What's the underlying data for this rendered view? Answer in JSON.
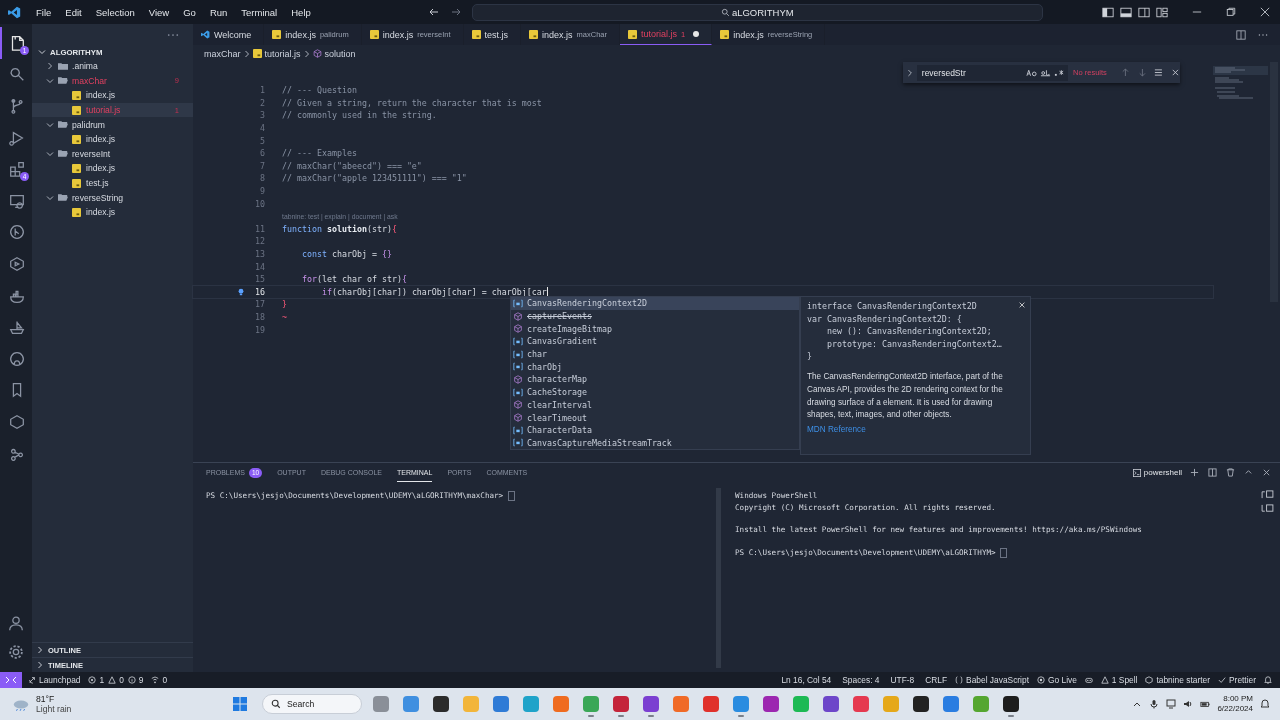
{
  "menu": [
    "File",
    "Edit",
    "Selection",
    "View",
    "Go",
    "Run",
    "Terminal",
    "Help"
  ],
  "command_center": "aLGORITHYM",
  "activity": [
    {
      "kind": "files",
      "badge": "1",
      "selected": true
    },
    {
      "kind": "search",
      "selected": false
    },
    {
      "kind": "scm",
      "selected": false
    },
    {
      "kind": "debug",
      "selected": false
    },
    {
      "kind": "extensions",
      "badge": "4",
      "selected": false
    },
    {
      "kind": "remote",
      "selected": false
    },
    {
      "kind": "graph",
      "selected": false
    },
    {
      "kind": "test",
      "selected": false
    },
    {
      "kind": "docker",
      "selected": false
    },
    {
      "kind": "ship",
      "selected": false
    },
    {
      "kind": "github",
      "selected": false
    },
    {
      "kind": "bookmark",
      "selected": false
    },
    {
      "kind": "tabnine",
      "selected": false
    },
    {
      "kind": "share",
      "selected": false
    }
  ],
  "explorer": {
    "title": "ALGORITHYM",
    "tree": [
      {
        "name": ".anima",
        "kind": "folder",
        "expanded": false,
        "error": false,
        "selected": false
      },
      {
        "name": "maxChar",
        "kind": "folder",
        "expanded": true,
        "error": true,
        "badge": "9",
        "selected": false,
        "children": [
          {
            "name": "index.js",
            "kind": "file",
            "error": false,
            "selected": false
          },
          {
            "name": "tutorial.js",
            "kind": "file",
            "error": true,
            "badge": "1",
            "selected": true
          }
        ]
      },
      {
        "name": "palidrum",
        "kind": "folder",
        "expanded": true,
        "error": false,
        "selected": false,
        "children": [
          {
            "name": "index.js",
            "kind": "file",
            "error": false,
            "selected": false
          }
        ]
      },
      {
        "name": "reverseInt",
        "kind": "folder",
        "expanded": true,
        "error": false,
        "selected": false,
        "children": [
          {
            "name": "index.js",
            "kind": "file",
            "error": false,
            "selected": false
          },
          {
            "name": "test.js",
            "kind": "file",
            "error": false,
            "selected": false
          }
        ]
      },
      {
        "name": "reverseString",
        "kind": "folder",
        "expanded": true,
        "error": false,
        "selected": false,
        "children": [
          {
            "name": "index.js",
            "kind": "file",
            "error": false,
            "selected": false
          }
        ]
      }
    ],
    "sections": [
      {
        "label": "OUTLINE",
        "expanded": false
      },
      {
        "label": "TIMELINE",
        "expanded": false
      }
    ]
  },
  "tabs": [
    {
      "label": "Welcome",
      "kind": "welcome",
      "selected": false,
      "error": false,
      "modified": false
    },
    {
      "label": "index.js",
      "description": "palidrum",
      "kind": "js",
      "selected": false,
      "error": false,
      "modified": false
    },
    {
      "label": "index.js",
      "description": "reverseInt",
      "kind": "js",
      "selected": false,
      "error": false,
      "modified": false
    },
    {
      "label": "test.js",
      "kind": "js",
      "selected": false,
      "error": false,
      "modified": false
    },
    {
      "label": "index.js",
      "description": "maxChar",
      "kind": "js",
      "selected": false,
      "error": false,
      "modified": false
    },
    {
      "label": "tutorial.js",
      "badge": "1",
      "kind": "js",
      "selected": true,
      "error": true,
      "modified": true
    },
    {
      "label": "index.js",
      "description": "reverseString",
      "kind": "js",
      "selected": false,
      "error": false,
      "modified": false
    }
  ],
  "breadcrumbs": [
    {
      "label": "maxChar",
      "kind": "folder"
    },
    {
      "label": "tutorial.js",
      "kind": "js"
    },
    {
      "label": "solution",
      "kind": "function"
    }
  ],
  "find": {
    "value": "reversedStr",
    "result": "No results"
  },
  "lines": [
    {
      "n": "1",
      "segs": [
        {
          "text": "// --- Question",
          "kind": "comment"
        }
      ]
    },
    {
      "n": "2",
      "segs": [
        {
          "text": "// Given a string, return the character that is most",
          "kind": "comment"
        }
      ]
    },
    {
      "n": "3",
      "segs": [
        {
          "text": "// commonly used in the string.",
          "kind": "comment"
        }
      ]
    },
    {
      "n": "4"
    },
    {
      "n": "5"
    },
    {
      "n": "6",
      "segs": [
        {
          "text": "// --- Examples",
          "kind": "comment"
        }
      ]
    },
    {
      "n": "7",
      "segs": [
        {
          "text": "// maxChar(\"abeecd\") === \"e\"",
          "kind": "comment"
        }
      ]
    },
    {
      "n": "8",
      "segs": [
        {
          "text": "// maxChar(\"apple 123451111\") === \"1\"",
          "kind": "comment"
        }
      ]
    },
    {
      "n": "9"
    },
    {
      "n": "10"
    },
    {
      "kind": "codelens",
      "text": "tabnine: test | explain | document | ask"
    },
    {
      "n": "11",
      "segs": [
        {
          "text": "function ",
          "kind": "keyword"
        },
        {
          "text": "solution",
          "kind": "function"
        },
        {
          "text": "(str)",
          "kind": "plain"
        },
        {
          "text": "{",
          "kind": "error"
        }
      ]
    },
    {
      "n": "12"
    },
    {
      "n": "13",
      "segs": [
        {
          "text": "    const ",
          "kind": "keyword"
        },
        {
          "text": "charObj = ",
          "kind": "plain"
        },
        {
          "text": "{}",
          "kind": "brace"
        }
      ]
    },
    {
      "n": "14"
    },
    {
      "n": "15",
      "segs": [
        {
          "text": "    for",
          "kind": "control"
        },
        {
          "text": "(let char of str)",
          "kind": "plain"
        },
        {
          "text": "{",
          "kind": "brace"
        }
      ]
    },
    {
      "n": "16",
      "current": true,
      "segs": [
        {
          "text": "        if",
          "kind": "control"
        },
        {
          "text": "(charObj[char]) charObj[char] = charObj[car",
          "kind": "plain"
        }
      ]
    },
    {
      "n": "17",
      "segs": [
        {
          "text": "}",
          "kind": "error"
        }
      ]
    },
    {
      "n": "18",
      "segs": [
        {
          "text": "~",
          "kind": "error"
        }
      ]
    },
    {
      "n": "19"
    }
  ],
  "suggest": {
    "items": [
      {
        "label": "CanvasRenderingContext2D",
        "kind": "variable",
        "selected": true,
        "deprecated": false
      },
      {
        "label": "captureEvents",
        "kind": "method",
        "selected": false,
        "deprecated": true
      },
      {
        "label": "createImageBitmap",
        "kind": "method",
        "selected": false,
        "deprecated": false
      },
      {
        "label": "CanvasGradient",
        "kind": "variable",
        "selected": false,
        "deprecated": false
      },
      {
        "label": "char",
        "kind": "variable",
        "selected": false,
        "deprecated": false
      },
      {
        "label": "charObj",
        "kind": "variable",
        "selected": false,
        "deprecated": false
      },
      {
        "label": "characterMap",
        "kind": "method",
        "selected": false,
        "deprecated": false
      },
      {
        "label": "CacheStorage",
        "kind": "variable",
        "selected": false,
        "deprecated": false
      },
      {
        "label": "clearInterval",
        "kind": "method",
        "selected": false,
        "deprecated": false
      },
      {
        "label": "clearTimeout",
        "kind": "method",
        "selected": false,
        "deprecated": false
      },
      {
        "label": "CharacterData",
        "kind": "variable",
        "selected": false,
        "deprecated": false
      },
      {
        "label": "CanvasCaptureMediaStreamTrack",
        "kind": "variable",
        "selected": false,
        "deprecated": false
      }
    ],
    "detail_code": [
      "interface CanvasRenderingContext2D",
      "var CanvasRenderingContext2D: {",
      "    new (): CanvasRenderingContext2D;",
      "    prototype: CanvasRenderingContext2…",
      "}"
    ],
    "description": "The CanvasRenderingContext2D interface, part of the Canvas API, provides the 2D rendering context for the drawing surface of a element. It is used for drawing shapes, text, images, and other objects.",
    "link": "MDN Reference"
  },
  "panel": {
    "tabs": [
      {
        "label": "PROBLEMS",
        "badge": "10",
        "selected": false
      },
      {
        "label": "OUTPUT",
        "selected": false
      },
      {
        "label": "DEBUG CONSOLE",
        "selected": false
      },
      {
        "label": "TERMINAL",
        "selected": true
      },
      {
        "label": "PORTS",
        "selected": false
      },
      {
        "label": "COMMENTS",
        "selected": false
      }
    ],
    "shell": "powershell",
    "left_terminal": [
      [
        "PS C:\\Users\\jesjo\\Documents\\Development\\UDEMY\\aLGORITHYM\\maxChar> "
      ]
    ],
    "right_terminal": [
      [
        "Windows PowerShell",
        "Copyright (C) Microsoft Corporation. All rights reserved."
      ],
      [
        "Install the latest PowerShell for new features and improvements! https://aka.ms/PSWindows"
      ],
      [
        "PS C:\\Users\\jesjo\\Documents\\Development\\UDEMY\\aLGORITHYM> "
      ]
    ]
  },
  "status": {
    "launchpad": "Launchpad",
    "errors": "1",
    "warnings": "0",
    "infos": "9",
    "ports": "0",
    "right": [
      {
        "kind": "text",
        "text": "Ln 16, Col 54"
      },
      {
        "kind": "text",
        "text": "Spaces: 4"
      },
      {
        "kind": "text",
        "text": "UTF-8"
      },
      {
        "kind": "text",
        "text": "CRLF"
      },
      {
        "kind": "braces",
        "text": "Babel JavaScript"
      },
      {
        "kind": "live",
        "text": "Go Live"
      },
      {
        "kind": "bot"
      },
      {
        "kind": "warning",
        "text": "1 Spell"
      },
      {
        "kind": "tabnine",
        "text": "tabnine starter"
      },
      {
        "kind": "check",
        "text": "Prettier"
      },
      {
        "kind": "bell"
      }
    ]
  },
  "taskbar": {
    "temperature": "81°F",
    "weather": "Light rain",
    "search": "Search",
    "time": "8:00 PM",
    "date": "6/22/2024",
    "apps": [
      {
        "color": "#8a8f98",
        "running": false
      },
      {
        "color": "#3f8fe0",
        "running": false
      },
      {
        "color": "#2b2b2b",
        "running": false
      },
      {
        "color": "#f2b53a",
        "running": false
      },
      {
        "color": "#2f7bd6",
        "running": false
      },
      {
        "color": "#1fa3c9",
        "running": false
      },
      {
        "color": "#ef6b1f",
        "running": false
      },
      {
        "color": "#3aa757",
        "running": true
      },
      {
        "color": "#c4243a",
        "running": true
      },
      {
        "color": "#7b3fd1",
        "running": true
      },
      {
        "color": "#f06a27",
        "running": false
      },
      {
        "color": "#e0312b",
        "running": false
      },
      {
        "color": "#2a8ce0",
        "running": true
      },
      {
        "color": "#9c27b0",
        "running": false
      },
      {
        "color": "#1db954",
        "running": false
      },
      {
        "color": "#6d46c9",
        "running": false
      },
      {
        "color": "#e53950",
        "running": false
      },
      {
        "color": "#e5a81a",
        "running": false
      },
      {
        "color": "#222222",
        "running": false
      },
      {
        "color": "#2a7de1",
        "running": false
      },
      {
        "color": "#55a630",
        "running": false
      },
      {
        "color": "#1d1d1d",
        "running": true
      }
    ]
  }
}
